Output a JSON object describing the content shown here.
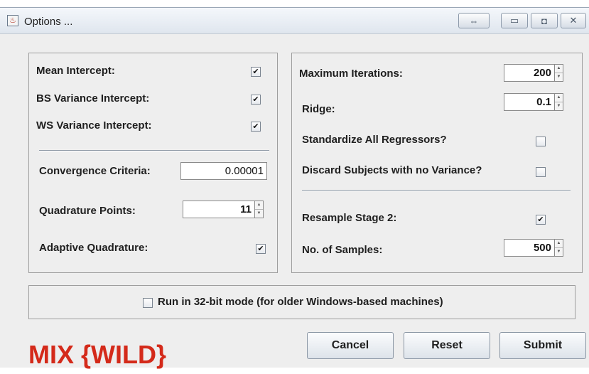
{
  "window": {
    "title": "Options ...",
    "app_icon": "java-icon",
    "controls": [
      "swap-icon",
      "minimize-icon",
      "maximize-icon",
      "close-icon"
    ]
  },
  "left": {
    "mean_intercept": {
      "label": "Mean Intercept:",
      "checked": true
    },
    "bs_variance": {
      "label": "BS Variance Intercept:",
      "checked": true
    },
    "ws_variance": {
      "label": "WS Variance Intercept:",
      "checked": true
    },
    "convergence": {
      "label": "Convergence Criteria:",
      "value": "0.00001"
    },
    "quadrature_points": {
      "label": "Quadrature Points:",
      "value": "11"
    },
    "adaptive_quadrature": {
      "label": "Adaptive Quadrature:",
      "checked": true
    }
  },
  "right": {
    "max_iterations": {
      "label": "Maximum Iterations:",
      "value": "200"
    },
    "ridge": {
      "label": "Ridge:",
      "value": "0.1"
    },
    "standardize": {
      "label": "Standardize All Regressors?",
      "checked": false
    },
    "discard": {
      "label": "Discard Subjects with no Variance?",
      "checked": false
    },
    "resample": {
      "label": "Resample Stage 2:",
      "checked": true
    },
    "samples": {
      "label": "No. of  Samples:",
      "value": "500"
    }
  },
  "mode32": {
    "label": "Run in 32-bit mode (for older Windows-based machines)",
    "checked": false
  },
  "buttons": {
    "cancel": "Cancel",
    "reset": "Reset",
    "submit": "Submit"
  },
  "logo": {
    "text": "MIX {WILD}",
    "color": "#d42a1a"
  },
  "colors": {
    "check_mark": "#111111"
  }
}
